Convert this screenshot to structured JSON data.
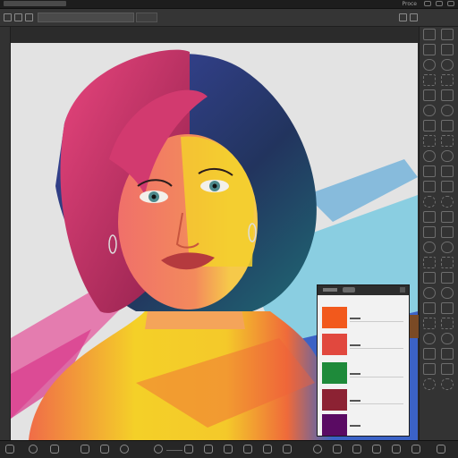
{
  "topbar": {
    "right_text": "Proce"
  },
  "panel": {
    "swatches": [
      {
        "color": "#f2591c"
      },
      {
        "color": "#e1483e"
      },
      {
        "color": "#1e8a3a"
      },
      {
        "color": "#8c2233"
      },
      {
        "color": "#5a0b63"
      }
    ]
  },
  "colors": {
    "ui_dark": "#2b2b2b",
    "canvas_bg": "#e3e3e3",
    "accent_yellow": "#f1cf25",
    "accent_blue": "#3a63c4",
    "accent_teal": "#66c6d8",
    "accent_pink": "#e04f8d"
  },
  "icons": {
    "bottom_bar": [
      "hand-icon",
      "brush-icon",
      "eraser-icon",
      "rectangle-icon",
      "ellipse-icon",
      "circle-icon",
      "lasso-icon",
      "zoom-icon"
    ],
    "right_bar": [
      "layers-icon",
      "adjust-icon",
      "history-icon"
    ]
  }
}
